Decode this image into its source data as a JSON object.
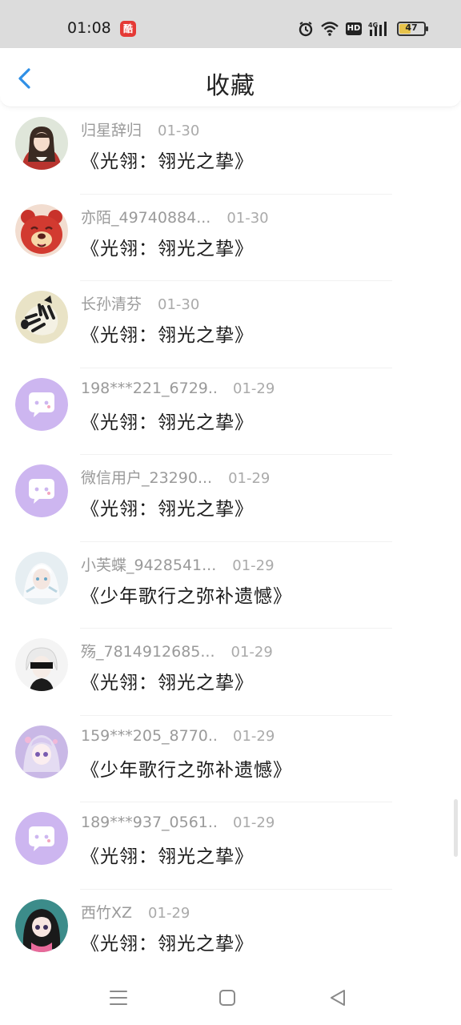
{
  "status_bar": {
    "time": "01:08",
    "app_badge": "酷",
    "hd_label": "HD",
    "network_label": "4G",
    "battery_level": "47",
    "battery_fraction": 0.47
  },
  "header": {
    "title": "收藏",
    "accent_color": "#2f8fe6"
  },
  "items": [
    {
      "username": "归星辞归",
      "date": "01-30",
      "title": "《光翎：翎光之挚》",
      "avatar": "anime-girl-avatar"
    },
    {
      "username": "亦陌_49740884...",
      "date": "01-30",
      "title": "《光翎：翎光之挚》",
      "avatar": "red-bear-avatar"
    },
    {
      "username": "长孙清芬",
      "date": "01-30",
      "title": "《光翎：翎光之挚》",
      "avatar": "zebra-avatar"
    },
    {
      "username": "198***221_6729...",
      "date": "01-29",
      "title": "《光翎：翎光之挚》",
      "avatar": "default-chat-avatar"
    },
    {
      "username": "微信用户_23290...",
      "date": "01-29",
      "title": "《光翎：翎光之挚》",
      "avatar": "default-chat-avatar"
    },
    {
      "username": "小芙蝶_9428541...",
      "date": "01-29",
      "title": "《少年歌行之弥补遗憾》",
      "avatar": "white-hair-anime-avatar"
    },
    {
      "username": "殇_7814912685...",
      "date": "01-29",
      "title": "《光翎：翎光之挚》",
      "avatar": "blindfold-avatar"
    },
    {
      "username": "159***205_8770...",
      "date": "01-29",
      "title": "《少年歌行之弥补遗憾》",
      "avatar": "purple-anime-avatar"
    },
    {
      "username": "189***937_0561...",
      "date": "01-29",
      "title": "《光翎：翎光之挚》",
      "avatar": "default-chat-avatar"
    },
    {
      "username": "西竹XZ",
      "date": "01-29",
      "title": "《光翎：翎光之挚》",
      "avatar": "dark-hair-anime-avatar"
    }
  ],
  "colors": {
    "default_avatar_bg": "#cdb6f0",
    "username_gray": "#9a9a9a"
  }
}
